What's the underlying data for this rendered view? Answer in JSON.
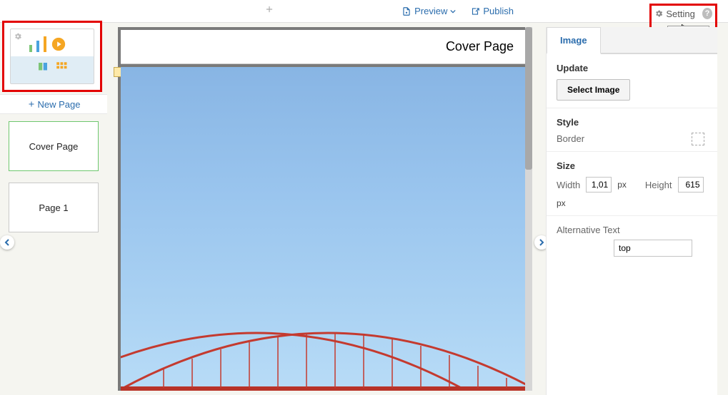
{
  "topbar": {
    "preview_label": "Preview",
    "publish_label": "Publish",
    "setting_label": "Setting",
    "setting_tooltip": "Setting"
  },
  "leftcol": {
    "new_page_label": "New Page",
    "pages": [
      {
        "label": "Cover Page",
        "active": true
      },
      {
        "label": "Page 1",
        "active": false
      }
    ]
  },
  "canvas": {
    "title": "Cover Page"
  },
  "props": {
    "tab_image": "Image",
    "update_heading": "Update",
    "select_image_btn": "Select Image",
    "style_heading": "Style",
    "border_label": "Border",
    "size_heading": "Size",
    "width_label": "Width",
    "height_label": "Height",
    "width_value": "1,01",
    "height_value": "615",
    "px_unit": "px",
    "alt_heading": "Alternative Text",
    "alt_value": "top"
  }
}
